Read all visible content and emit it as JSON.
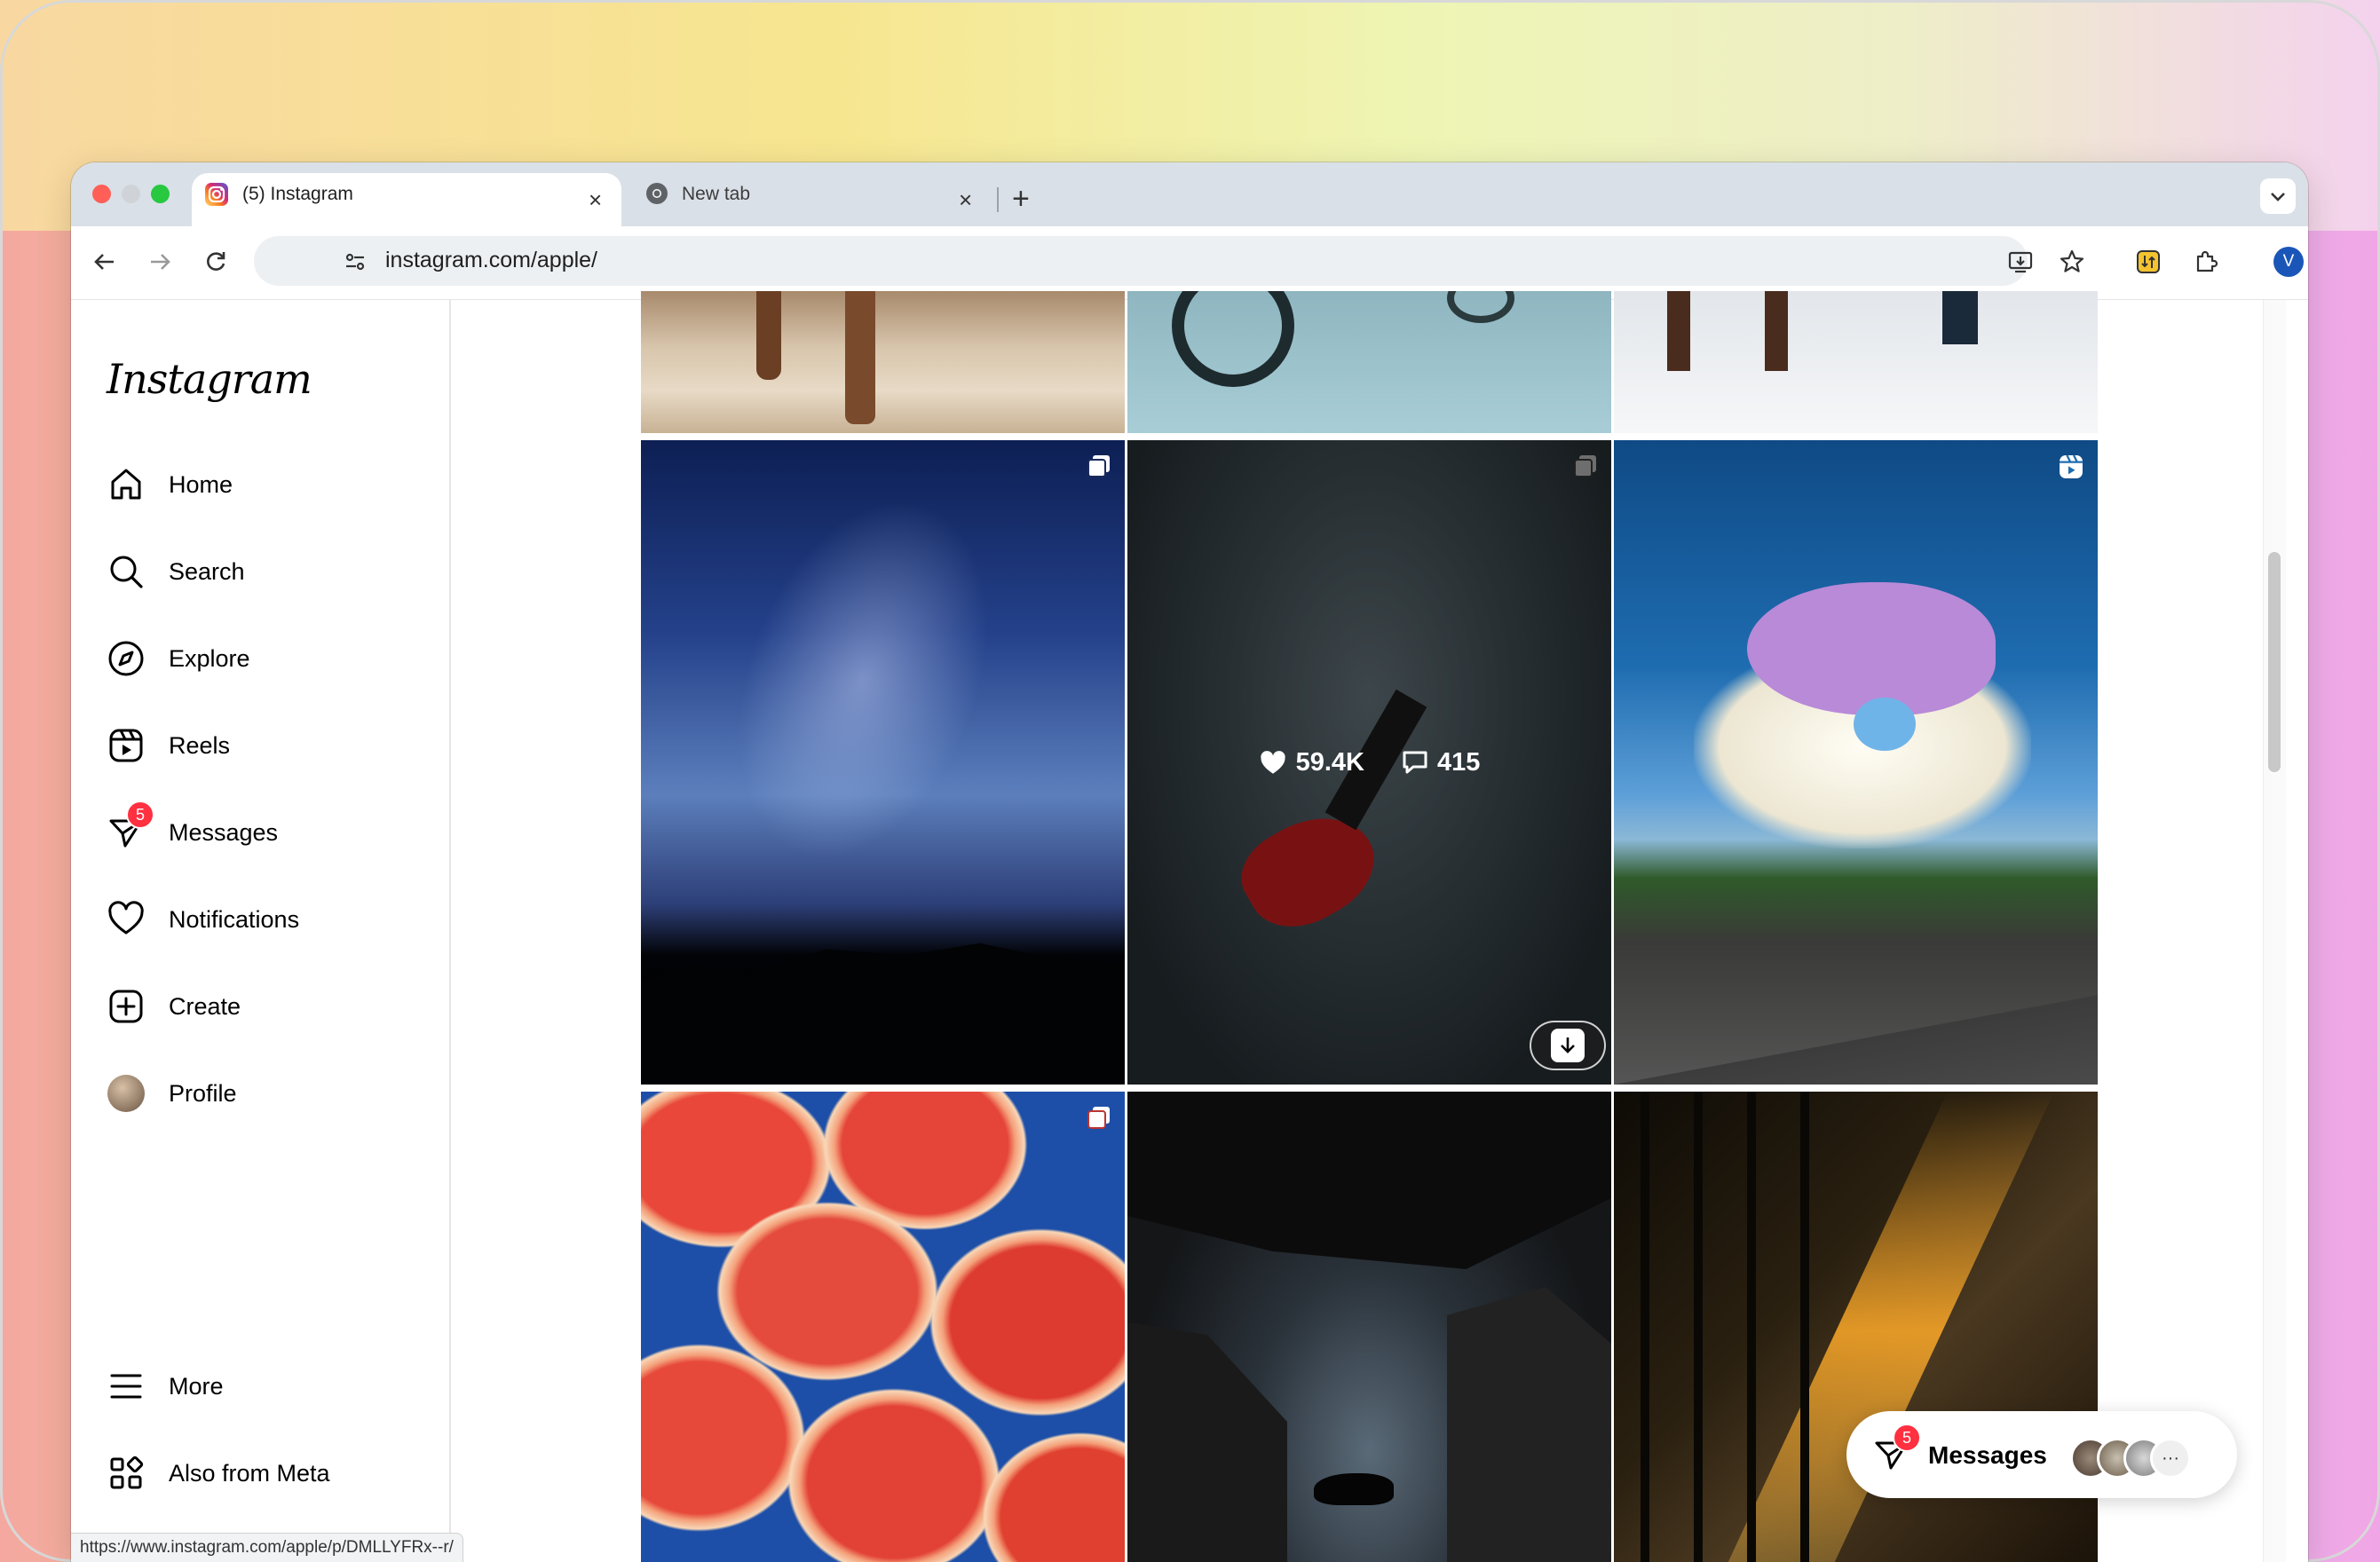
{
  "browser": {
    "tabs": [
      {
        "title": "(5) Instagram",
        "active": true,
        "favicon": "instagram-icon"
      },
      {
        "title": "New tab",
        "active": false,
        "favicon": "chrome-icon"
      }
    ],
    "url": "instagram.com/apple/",
    "profile_initial": "V",
    "status_url": "https://www.instagram.com/apple/p/DMLLYFRx--r/"
  },
  "sidebar": {
    "logo": "Instagram",
    "items": [
      {
        "label": "Home",
        "icon": "home-icon"
      },
      {
        "label": "Search",
        "icon": "search-icon"
      },
      {
        "label": "Explore",
        "icon": "compass-icon"
      },
      {
        "label": "Reels",
        "icon": "reels-icon"
      },
      {
        "label": "Messages",
        "icon": "messenger-icon",
        "badge": "5"
      },
      {
        "label": "Notifications",
        "icon": "heart-icon"
      },
      {
        "label": "Create",
        "icon": "plus-square-icon"
      },
      {
        "label": "Profile",
        "icon": "avatar"
      }
    ],
    "bottom": [
      {
        "label": "More",
        "icon": "menu-icon"
      },
      {
        "label": "Also from Meta",
        "icon": "meta-grid-icon"
      }
    ]
  },
  "grid": {
    "hovered_post": {
      "likes": "59.4K",
      "comments": "415"
    }
  },
  "messages_pill": {
    "label": "Messages",
    "badge": "5"
  },
  "colors": {
    "accent": "#0095f6",
    "badge": "#ff3040"
  }
}
